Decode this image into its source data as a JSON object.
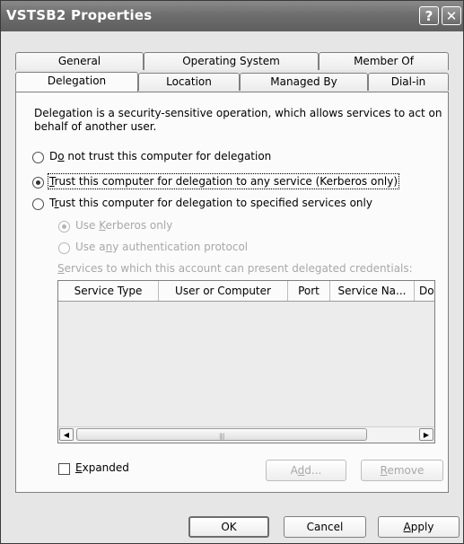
{
  "window": {
    "title": "VSTSB2 Properties",
    "help_icon": "?",
    "close_icon": "✕"
  },
  "tabs_top": [
    "General",
    "Operating System",
    "Member Of"
  ],
  "tabs_bottom": [
    "Delegation",
    "Location",
    "Managed By",
    "Dial-in"
  ],
  "active_tab": "Delegation",
  "description": "Delegation is a security-sensitive operation, which allows services to act on behalf of another user.",
  "options": {
    "no_trust": {
      "pre": "D",
      "ul": "o",
      "post": " not trust this computer for delegation"
    },
    "trust_any": {
      "pre": "",
      "ul": "T",
      "post": "rust this computer for delegation to any service (Kerberos only)"
    },
    "trust_specified": {
      "pre": "T",
      "ul": "r",
      "post": "ust this computer for delegation to specified services only"
    },
    "kerberos_only": {
      "pre": "Use ",
      "ul": "K",
      "post": "erberos only"
    },
    "any_protocol": {
      "pre": "Use a",
      "ul": "n",
      "post": "y authentication protocol"
    }
  },
  "services_label": {
    "pre": "",
    "ul": "S",
    "post": "ervices to which this account can present delegated credentials:"
  },
  "columns": [
    "Service Type",
    "User or Computer",
    "Port",
    "Service Na...",
    "Do"
  ],
  "expanded_label": {
    "pre": "",
    "ul": "E",
    "post": "xpanded"
  },
  "buttons": {
    "add": {
      "pre": "A",
      "ul": "d",
      "post": "d..."
    },
    "remove": {
      "pre": "",
      "ul": "R",
      "post": "emove"
    },
    "ok": "OK",
    "cancel": "Cancel",
    "apply": {
      "pre": "",
      "ul": "A",
      "post": "pply"
    }
  },
  "scroll_left_icon": "◀",
  "scroll_right_icon": "▶",
  "colors": {
    "titlebar": "#6e6e6e",
    "panel": "#fbfbfb",
    "disabled_text": "#a8a8a8"
  }
}
